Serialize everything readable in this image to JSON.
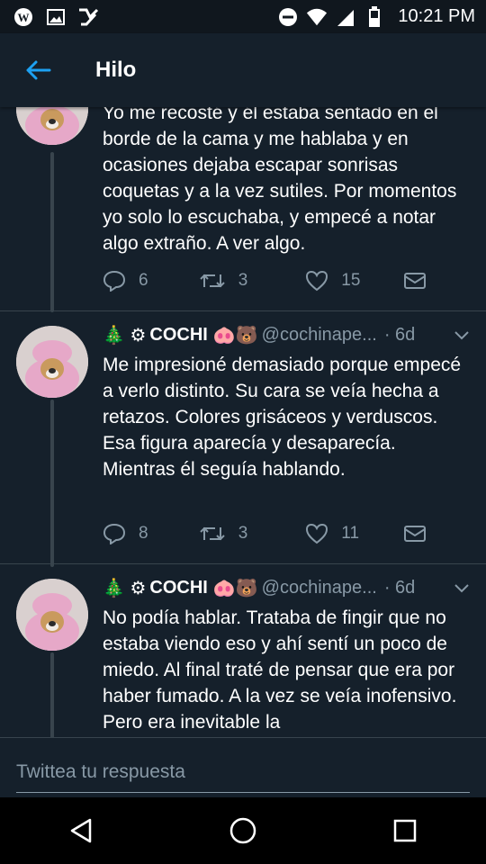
{
  "status_bar": {
    "left_icons": [
      "wordpress-icon",
      "image-icon",
      "check-badge-icon"
    ],
    "right_icons": [
      "do-not-disturb-icon",
      "wifi-icon",
      "signal-icon",
      "battery-icon"
    ],
    "time": "10:21 PM"
  },
  "header": {
    "title": "Hilo",
    "back_icon": "arrow-left-icon"
  },
  "tweets": [
    {
      "text": "Yo me recosté y él estaba sentado en el borde de la cama y me hablaba y en ocasiones dejaba escapar sonrisas coquetas y a la vez sutiles. Por momentos yo solo lo escuchaba, y empecé a notar algo extraño. A ver algo.",
      "replies": "6",
      "retweets": "3",
      "likes": "15"
    },
    {
      "emoji_prefix": "🎄 ⚙",
      "name": "COCHI",
      "emoji_suffix": "🐽🐻",
      "handle": "@cochinape...",
      "time": "· 6d",
      "text": "Me impresioné demasiado porque empecé a verlo distinto. Su cara se veía hecha a retazos. Colores grisáceos y verduscos. Esa figura aparecía y desaparecía. Mientras él seguía hablando.",
      "replies": "8",
      "retweets": "3",
      "likes": "11"
    },
    {
      "emoji_prefix": "🎄 ⚙",
      "name": "COCHI",
      "emoji_suffix": "🐽🐻",
      "handle": "@cochinape...",
      "time": "· 6d",
      "text": "No podía hablar. Trataba de fingir que no estaba viendo eso y ahí sentí un poco de miedo. Al final traté de pensar que era por haber fumado. A la vez se veía inofensivo. Pero era inevitable la"
    }
  ],
  "reply_bar": {
    "placeholder": "Twittea tu respuesta"
  },
  "colors": {
    "background": "#15202b",
    "secondary_text": "#8899a6",
    "accent": "#1da1f2",
    "divider": "#38444d"
  }
}
